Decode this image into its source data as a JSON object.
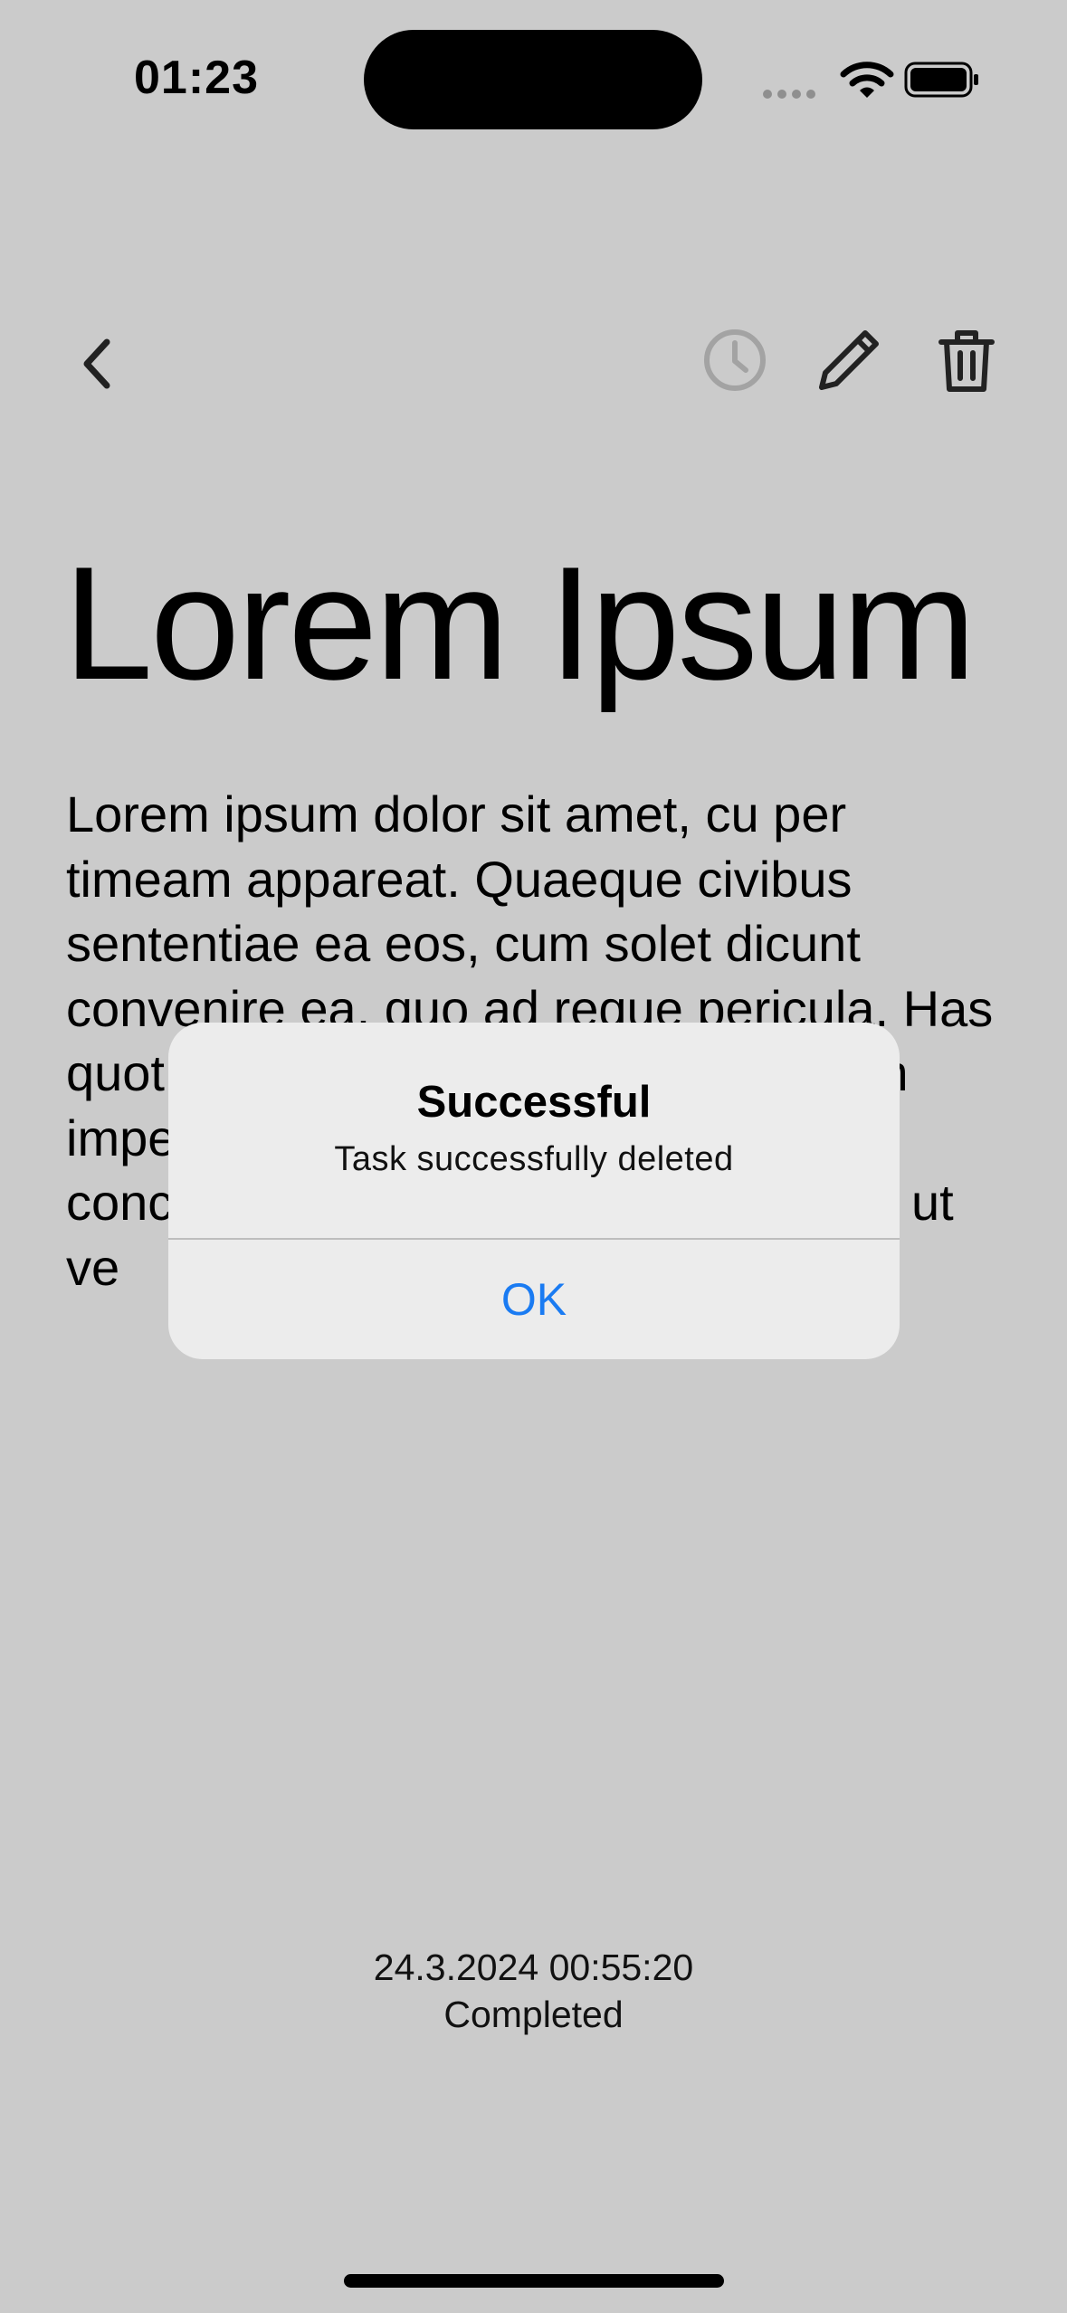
{
  "status_bar": {
    "time": "01:23",
    "icons": [
      "signal-dots-icon",
      "wifi-icon",
      "battery-icon"
    ]
  },
  "nav": {
    "icons": [
      "chevron-left-icon",
      "clock-icon",
      "pencil-icon",
      "trash-icon"
    ]
  },
  "task": {
    "title": "Lorem Ipsum",
    "body": "Lorem ipsum dolor sit amet, cu per timeam appareat. Quaeque civibus sententiae ea eos, cum solet dicunt convenire ea, quo ad reque pericula. Has quot ex, sit partem dicunt ut sit ut tum imperdiet ut ex ut sed ut, vix ut concludaturque an quod te. Cu ut ex, ut ve",
    "date": "24.3.2024 00:55:20",
    "status": "Completed"
  },
  "alert": {
    "title": "Successful",
    "message": "Task successfully deleted",
    "ok_label": "OK"
  },
  "colors": {
    "background": "#cbcbcb",
    "alert_background": "#ececec",
    "accent": "#1a7bf2"
  }
}
